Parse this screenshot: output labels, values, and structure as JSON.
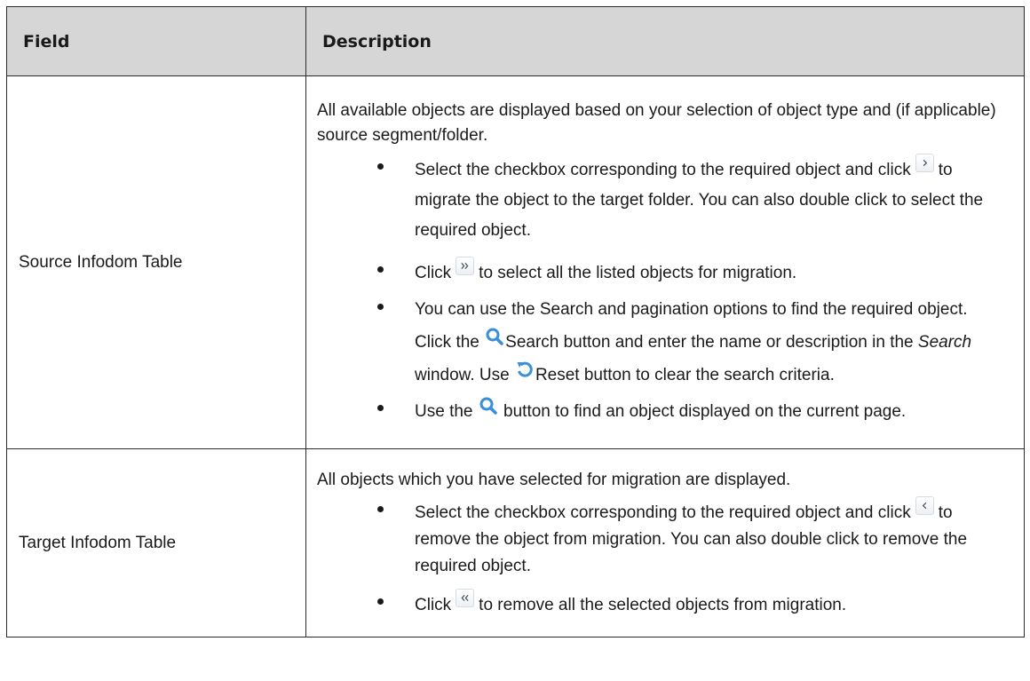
{
  "table": {
    "header": {
      "field": "Field",
      "description": "Description"
    },
    "rows": [
      {
        "field": "Source Infodom Table",
        "intro": "All available objects are displayed based on your selection of object type and (if applicable) source segment/folder.",
        "bullets": [
          {
            "part1": "Select the checkbox corresponding to the required object and click",
            "icon": "chevron-right-icon",
            "part2": "to migrate the object to the target folder. You can also double click to select the required object."
          },
          {
            "part1": "Click",
            "icon": "double-chevron-right-icon",
            "part2": "to select all the listed objects for migration."
          },
          {
            "part1": "You can use the Search and pagination options to find the required object. Click the",
            "icon": "search-icon",
            "part2": "Search button and enter the name or description in the",
            "emph": "Search",
            "part3": "window. Use",
            "icon2": "reset-icon",
            "part4": "Reset button to clear the search criteria."
          },
          {
            "part1": "Use the",
            "icon": "search-icon",
            "part2": "button to find an object displayed on the current page."
          }
        ]
      },
      {
        "field": "Target Infodom Table",
        "intro": "All objects which you have selected for migration are displayed.",
        "bullets": [
          {
            "part1": "Select the checkbox corresponding to the required object and click",
            "icon": "chevron-left-icon",
            "part2": "to remove the object from migration. You can also double click to remove the required object."
          },
          {
            "part1": "Click",
            "icon": "double-chevron-left-icon",
            "part2": "to remove all the selected objects from migration."
          }
        ]
      }
    ]
  },
  "colors": {
    "header_bg": "#d6d6d6",
    "border": "#2b2b2b",
    "icon_blue": "#3a8fd6"
  }
}
